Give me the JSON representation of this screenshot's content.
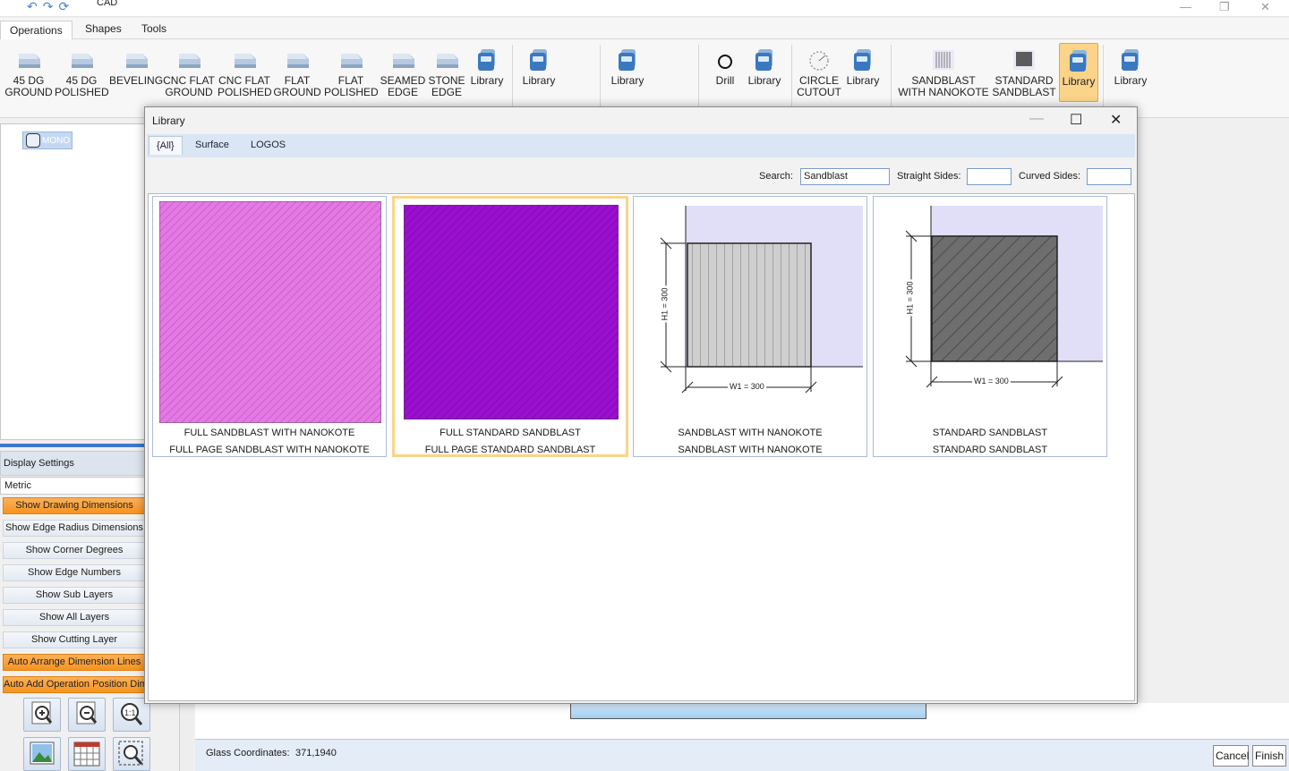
{
  "window": {
    "title": "CAD",
    "controls": {
      "minimize": "—",
      "restore": "❐",
      "close": "✕"
    },
    "quick_access": {
      "undo": "↶",
      "redo": "↷",
      "refresh": "⟳"
    }
  },
  "menu": {
    "tabs": [
      "Operations",
      "Shapes",
      "Tools"
    ]
  },
  "ribbon": {
    "buttons": [
      {
        "label": "45 DG GROUND",
        "icon": "edge-profile-icon"
      },
      {
        "label": "45 DG POLISHED",
        "icon": "edge-profile-icon"
      },
      {
        "label": "BEVELING",
        "icon": "edge-profile-icon"
      },
      {
        "label": "CNC FLAT GROUND",
        "icon": "edge-profile-icon"
      },
      {
        "label": "CNC FLAT POLISHED",
        "icon": "edge-profile-icon"
      },
      {
        "label": "FLAT GROUND",
        "icon": "edge-profile-icon"
      },
      {
        "label": "FLAT POLISHED",
        "icon": "edge-profile-icon"
      },
      {
        "label": "SEAMED EDGE",
        "icon": "edge-profile-icon"
      },
      {
        "label": "STONE EDGE",
        "icon": "edge-profile-icon"
      },
      {
        "label": "Library",
        "icon": "library-icon"
      },
      {
        "label": "Library",
        "icon": "library-icon"
      },
      {
        "label": "Library",
        "icon": "library-icon"
      },
      {
        "label": "Drill",
        "icon": "drill-icon"
      },
      {
        "label": "Library",
        "icon": "library-icon"
      },
      {
        "label": "CIRCLE CUTOUT",
        "icon": "circle-cutout-icon"
      },
      {
        "label": "Library",
        "icon": "library-icon"
      },
      {
        "label": "SANDBLAST WITH NANOKOTE",
        "icon": "sandblast-nanokote-icon"
      },
      {
        "label": "STANDARD SANDBLAST",
        "icon": "standard-sandblast-icon"
      },
      {
        "label": "Library",
        "icon": "library-icon"
      },
      {
        "label": "Library",
        "icon": "library-icon"
      }
    ],
    "accent": "#fbd48a"
  },
  "tree": {
    "node_label": "MONO"
  },
  "display_settings": {
    "header": "Display Settings",
    "unit": "Metric",
    "toggles": [
      {
        "label": "Show Drawing Dimensions",
        "on": true
      },
      {
        "label": "Show Edge Radius Dimensions",
        "on": false
      },
      {
        "label": "Show Corner Degrees",
        "on": false
      },
      {
        "label": "Show Edge Numbers",
        "on": false
      },
      {
        "label": "Show Sub Layers",
        "on": false
      },
      {
        "label": "Show All Layers",
        "on": false
      },
      {
        "label": "Show Cutting Layer",
        "on": false
      },
      {
        "label": "Auto Arrange Dimension Lines",
        "on": true
      },
      {
        "label": "Auto Add Operation Position Dimensions",
        "on": true
      }
    ],
    "active_color": "#f7931e"
  },
  "status": {
    "coords_label": "Glass Coordinates:",
    "coords_value": "371,1940",
    "cancel": "Cancel",
    "finish": "Finish"
  },
  "library_dialog": {
    "title": "Library",
    "controls": {
      "minimize": "—",
      "maximize": "☐",
      "close": "✕"
    },
    "tabs": [
      "{All}",
      "Surface",
      "LOGOS"
    ],
    "search_label": "Search:",
    "search_value": "Sandblast",
    "straight_label": "Straight Sides:",
    "straight_value": "",
    "curved_label": "Curved Sides:",
    "curved_value": "",
    "items": [
      {
        "title": "FULL SANDBLAST WITH NANOKOTE",
        "subtitle": "FULL PAGE SANDBLAST WITH NANOKOTE",
        "color": "#e06ce0"
      },
      {
        "title": "FULL STANDARD SANDBLAST",
        "subtitle": "FULL PAGE STANDARD SANDBLAST",
        "color": "#9b0fd0"
      },
      {
        "title": "SANDBLAST WITH NANOKOTE",
        "subtitle": "SANDBLAST WITH NANOKOTE",
        "h_label": "H1 = 300",
        "w_label": "W1 = 300"
      },
      {
        "title": "STANDARD SANDBLAST",
        "subtitle": "STANDARD  SANDBLAST",
        "h_label": "H1 = 300",
        "w_label": "W1 = 300"
      }
    ]
  }
}
